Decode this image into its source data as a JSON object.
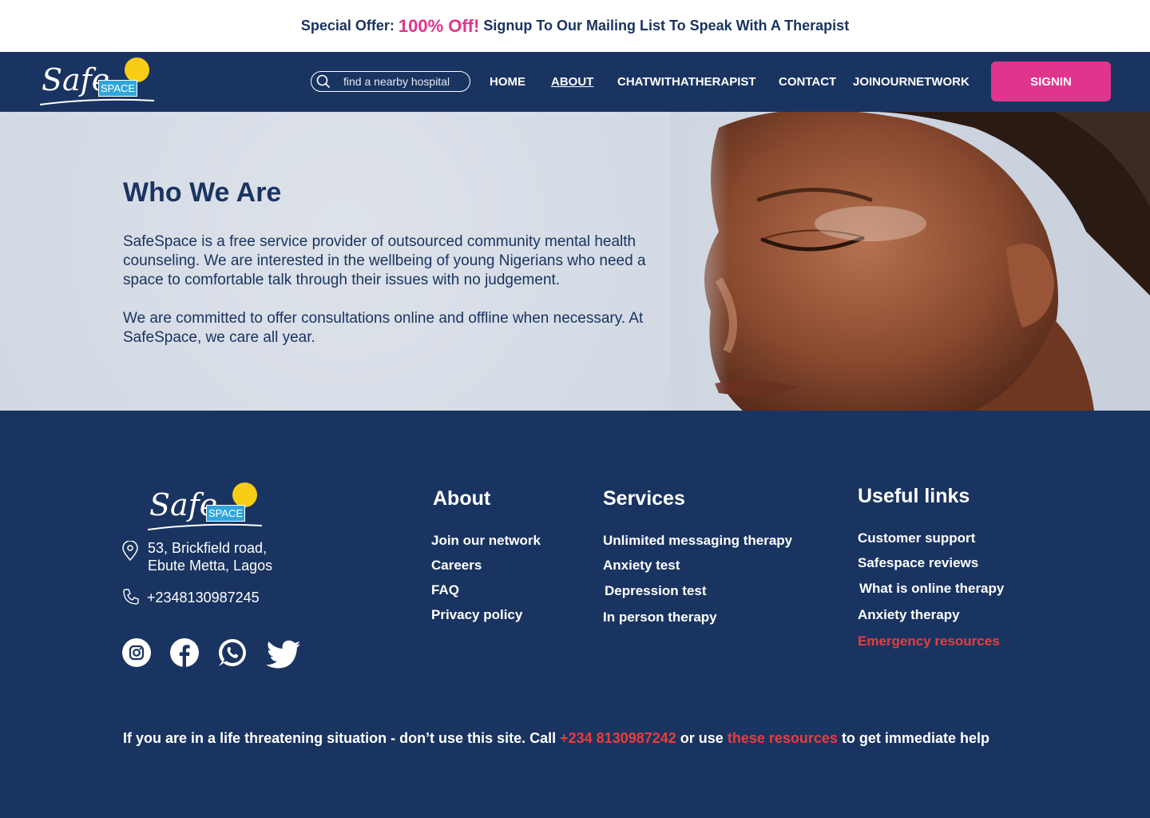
{
  "promo": {
    "prefix": "Special Offer:",
    "highlight": "100% Off!",
    "suffix": "Signup To Our Mailing List To Speak With A Therapist"
  },
  "brand": {
    "script": "Safe",
    "box": "SPACE"
  },
  "search": {
    "placeholder": "find a nearby hospital"
  },
  "nav": {
    "home": "HOME",
    "about": "ABOUT",
    "chat": "CHATWITHATHERAPIST",
    "contact": "CONTACT",
    "join": "JOINOURNETWORK",
    "signin": "SIGNIN"
  },
  "hero": {
    "title": "Who We Are",
    "p1": "SafeSpace is a free service provider of outsourced community mental health counseling. We are interested in the wellbeing of young Nigerians who need a space to comfortable talk through their issues with no judgement.",
    "p2": "We are committed to offer consultations online and offline when necessary. At SafeSpace, we care all year."
  },
  "footer": {
    "address_line1": "53, Brickfield road,",
    "address_line2": "Ebute Metta, Lagos",
    "phone": "+2348130987245",
    "about": {
      "heading": "About",
      "links": [
        "Join our network",
        "Careers",
        "FAQ",
        "Privacy policy"
      ]
    },
    "services": {
      "heading": "Services",
      "links": [
        "Unlimited messaging therapy",
        "Anxiety test",
        "Depression test",
        "In person therapy"
      ]
    },
    "useful": {
      "heading": "Useful links",
      "links": [
        "Customer support",
        "Safespace reviews",
        "What is online therapy",
        "Anxiety therapy",
        "Emergency resources"
      ]
    },
    "note": {
      "before": "If you are in a life threatening situation - don’t use this site. Call",
      "phone": "+234 8130987242",
      "middle": "or use",
      "link": "these resources",
      "after": "to get immediate help"
    }
  },
  "colors": {
    "navy": "#1a3461",
    "pink": "#e0358c",
    "red": "#e83d3d",
    "sun": "#f7cd15",
    "sky": "#2fa6dc"
  }
}
